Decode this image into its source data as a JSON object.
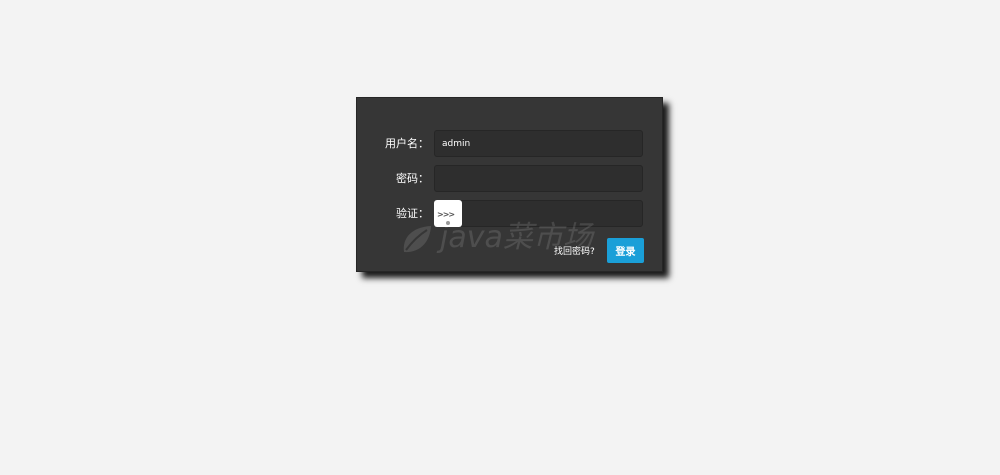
{
  "form": {
    "username_label": "用户名：",
    "username_value": "admin",
    "password_label": "密码：",
    "password_value": "",
    "captcha_label": "验证：",
    "captcha_image_text": ">>>",
    "captcha_value": "",
    "forgot_password": "找回密码?",
    "login_button": "登录"
  },
  "watermark": {
    "text": "java菜市场"
  },
  "colors": {
    "page_background": "#f3f3f3",
    "panel_background": "#363636",
    "field_background": "#2e2e2e",
    "accent": "#1a9fd8"
  },
  "icons": {
    "watermark_logo": "leaf-icon"
  }
}
